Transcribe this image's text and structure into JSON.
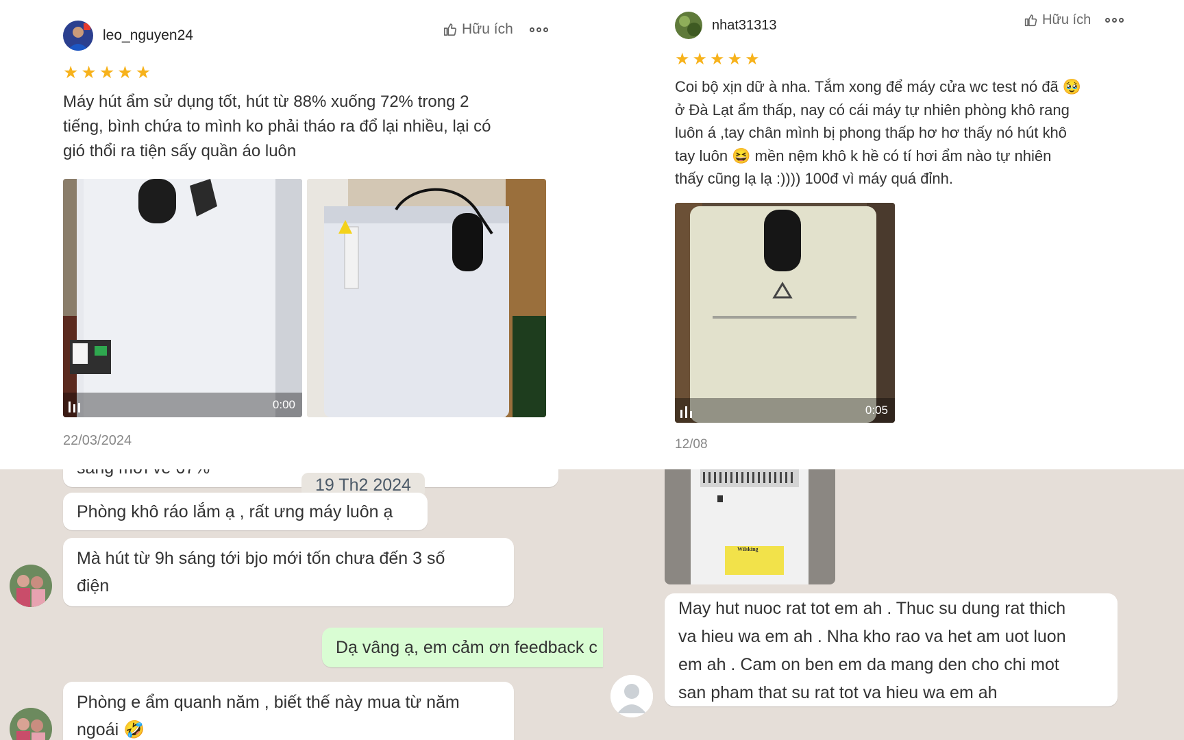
{
  "review_left": {
    "username": "leo_nguyen24",
    "helpful_label": "Hữu ích",
    "rating": 5,
    "text_lines": [
      "Máy hút ẩm sử dụng tốt, hút từ 88% xuống 72% trong 2",
      "tiếng, bình chứa to mình ko phải tháo ra đổ lại nhiều, lại có",
      "gió thổi ra tiện sấy quần áo luôn"
    ],
    "video_duration": "0:00",
    "date": "22/03/2024"
  },
  "review_right": {
    "username": "nhat31313",
    "helpful_label": "Hữu ích",
    "rating": 5,
    "text_lines": [
      "Coi bộ xịn dữ à nha. Tắm xong để máy cửa wc test nó đã 🥹",
      "ở Đà Lạt ẩm thấp, nay có cái máy tự nhiên phòng khô rang",
      "luôn á ,tay chân mình bị phong thấp hơ hơ thấy nó hút khô",
      "tay luôn 😆 mền nệm khô k hề có tí hơi ẩm nào tự nhiên",
      "thấy cũng lạ lạ :)))) 100đ vì máy quá đỉnh."
    ],
    "video_duration": "0:05",
    "date": "12/08"
  },
  "chat": {
    "partial_top": "sáng mới về 67%",
    "date_chip": "19 Th2 2024",
    "messages": [
      {
        "text_lines": [
          "Phòng khô ráo lắm ạ , rất ưng máy luôn ạ"
        ],
        "side": "in"
      },
      {
        "text_lines": [
          "Mà hút từ 9h sáng tới bjo mới tốn chưa đến 3 số",
          "điện"
        ],
        "side": "in"
      },
      {
        "text_lines": [
          "Dạ vâng ạ, em cảm ơn feedback c"
        ],
        "side": "out"
      },
      {
        "text_lines": [
          "Phòng e ẩm quanh năm , biết thế này mua từ năm",
          "ngoái 🤣"
        ],
        "side": "in"
      },
      {
        "text_lines": [
          "May hut nuoc rat tot em ah . Thuc su dung rat thich",
          "va hieu wa em ah . Nha kho rao va het am uot luon",
          "em ah . Cam on ben em da mang den cho chi mot",
          "san pham that su rat tot va hieu wa em ah"
        ],
        "side": "in"
      }
    ],
    "label_text": "Wilsking"
  },
  "colors": {
    "star": "#f7b21b",
    "chat_bg": "#e5ded8",
    "outgoing_bubble": "#d9fdd3"
  }
}
